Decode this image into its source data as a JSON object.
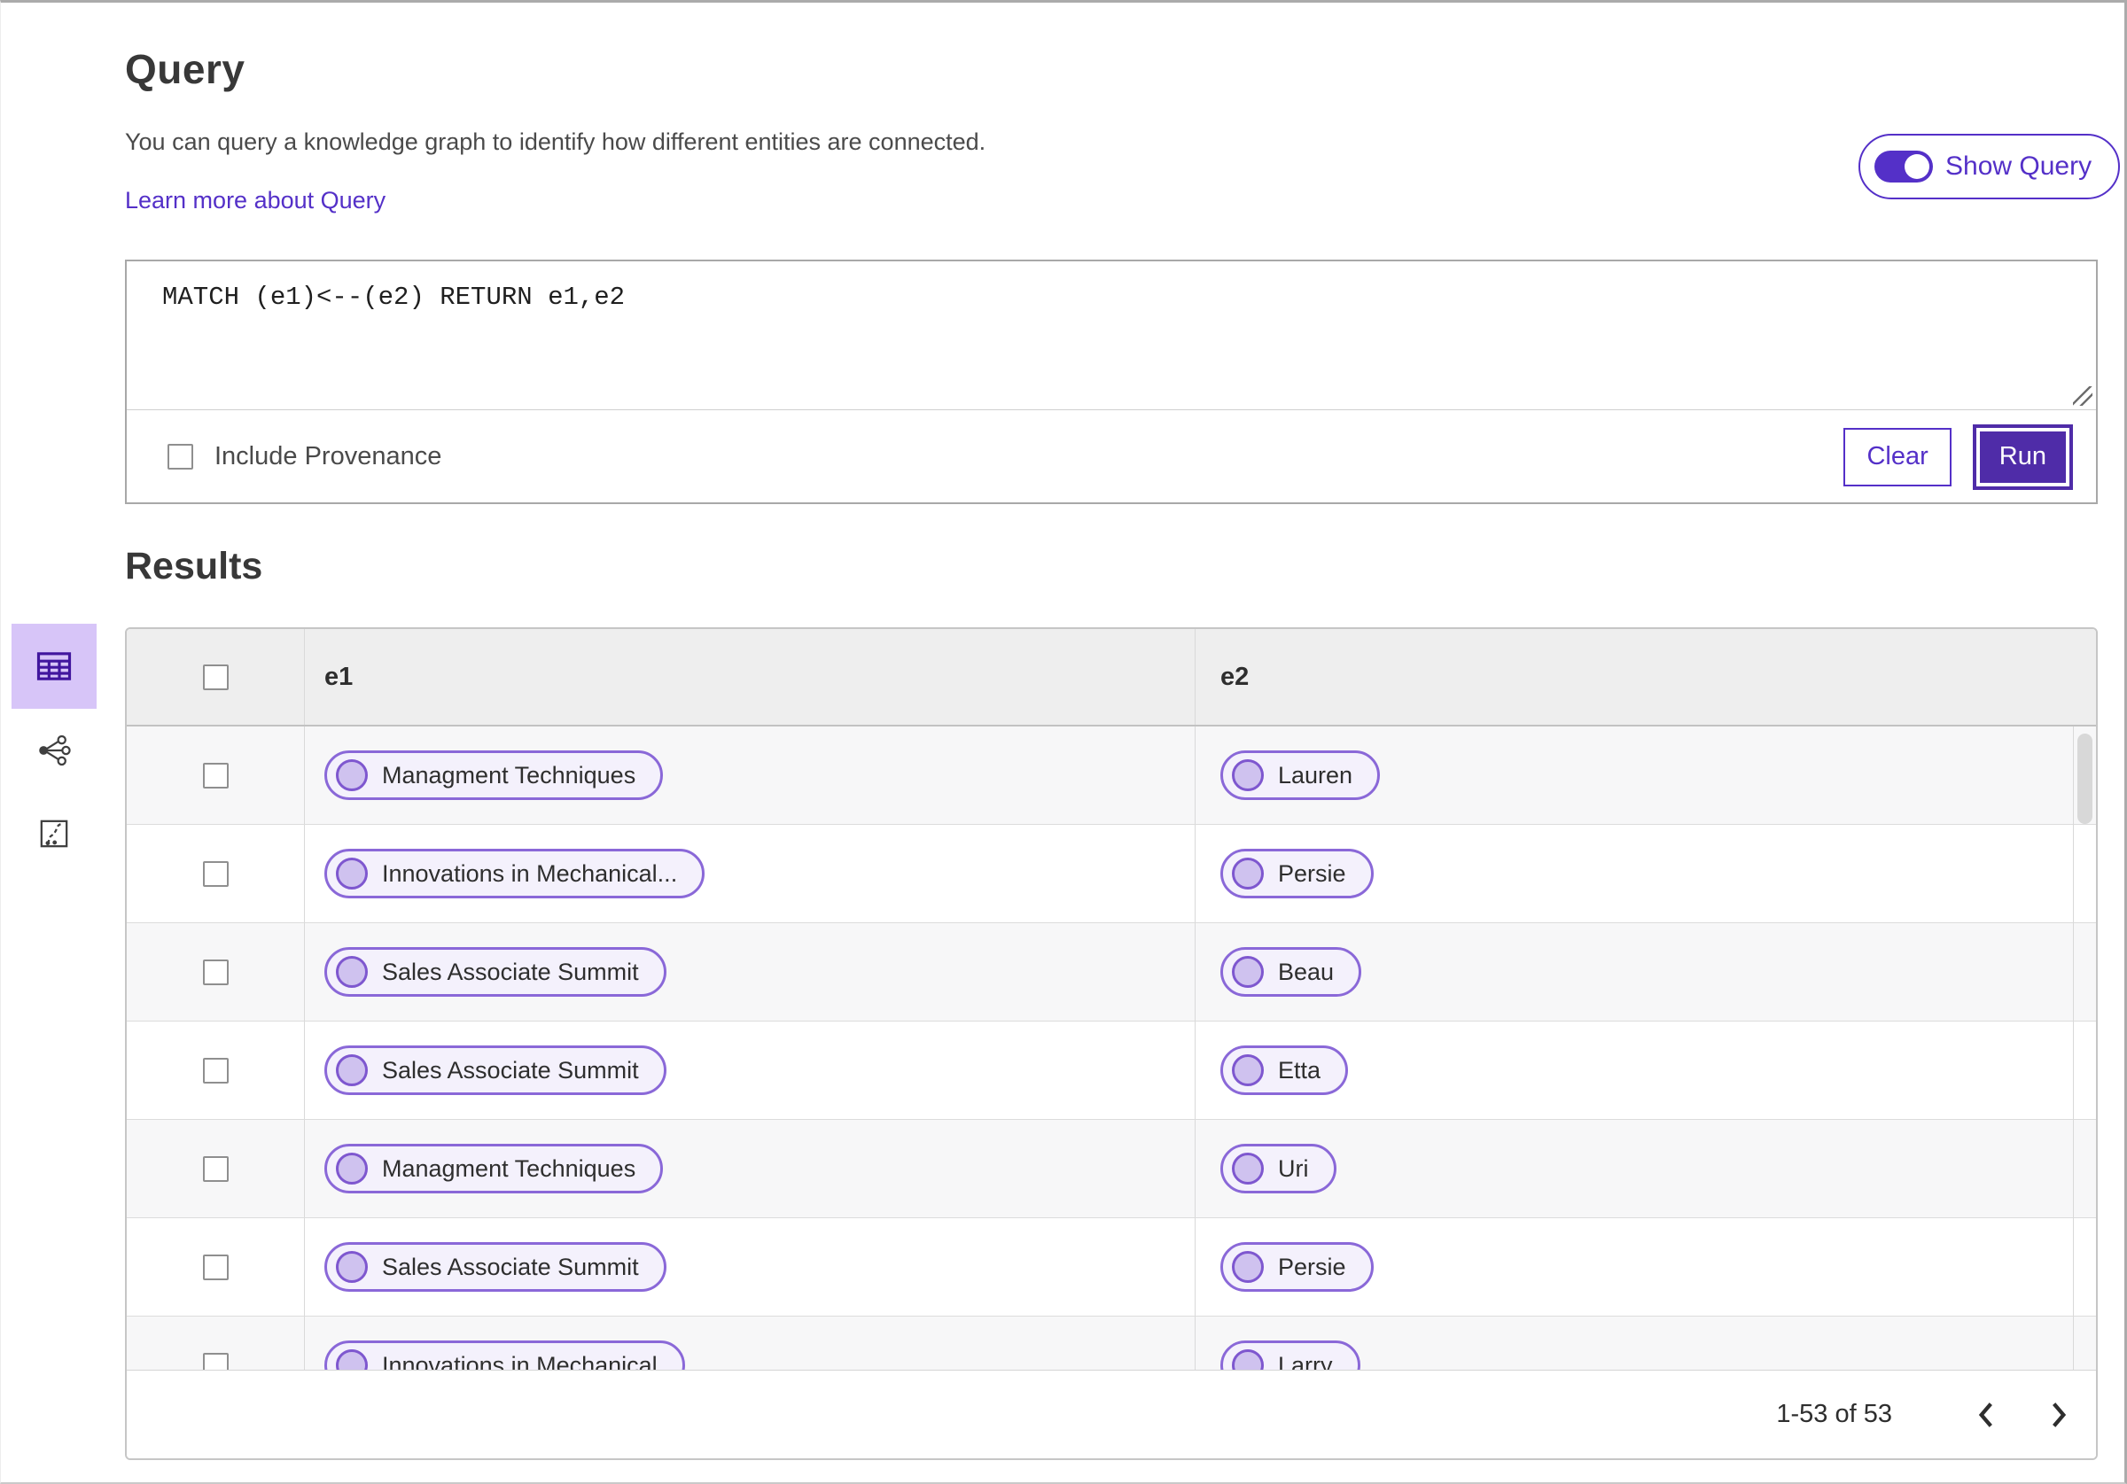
{
  "page": {
    "title": "Query",
    "description": "You can query a knowledge graph to identify how different entities are connected.",
    "learn_more_link": "Learn more about Query"
  },
  "query_panel": {
    "show_query_label": "Show Query",
    "show_query_toggle_state": "on",
    "query_code": "MATCH (e1)<--(e2) RETURN e1,e2",
    "include_provenance_label": "Include Provenance",
    "include_provenance_checked": false,
    "clear_button_label": "Clear",
    "run_button_label": "Run"
  },
  "results": {
    "title": "Results",
    "view_switcher": {
      "selected": "table-view",
      "icons": [
        "table-view-icon",
        "graph-view-icon",
        "map-view-icon"
      ]
    },
    "columns": {
      "col1": "e1",
      "col2": "e2"
    },
    "rows": [
      {
        "e1": "Managment Techniques",
        "e2": "Lauren"
      },
      {
        "e1": "Innovations in Mechanical...",
        "e2": "Persie"
      },
      {
        "e1": "Sales Associate Summit",
        "e2": "Beau"
      },
      {
        "e1": "Sales Associate Summit",
        "e2": "Etta"
      },
      {
        "e1": "Managment Techniques",
        "e2": "Uri"
      },
      {
        "e1": "Sales Associate Summit",
        "e2": "Persie"
      },
      {
        "e1": "Innovations in Mechanical",
        "e2": "Larry"
      }
    ],
    "pagination": {
      "range_label": "1-53 of 53"
    }
  },
  "colors": {
    "accent_purple": "#5430c8",
    "run_button_purple": "#4f2ca8",
    "pill_border": "#8a68d8",
    "pill_background": "#f4f1fc",
    "pill_dot_fill": "#cfc2ef",
    "selected_view_background": "#d7c5f8",
    "header_row_background": "#eeeeee",
    "zebra_stripe": "#f7f7f8"
  }
}
